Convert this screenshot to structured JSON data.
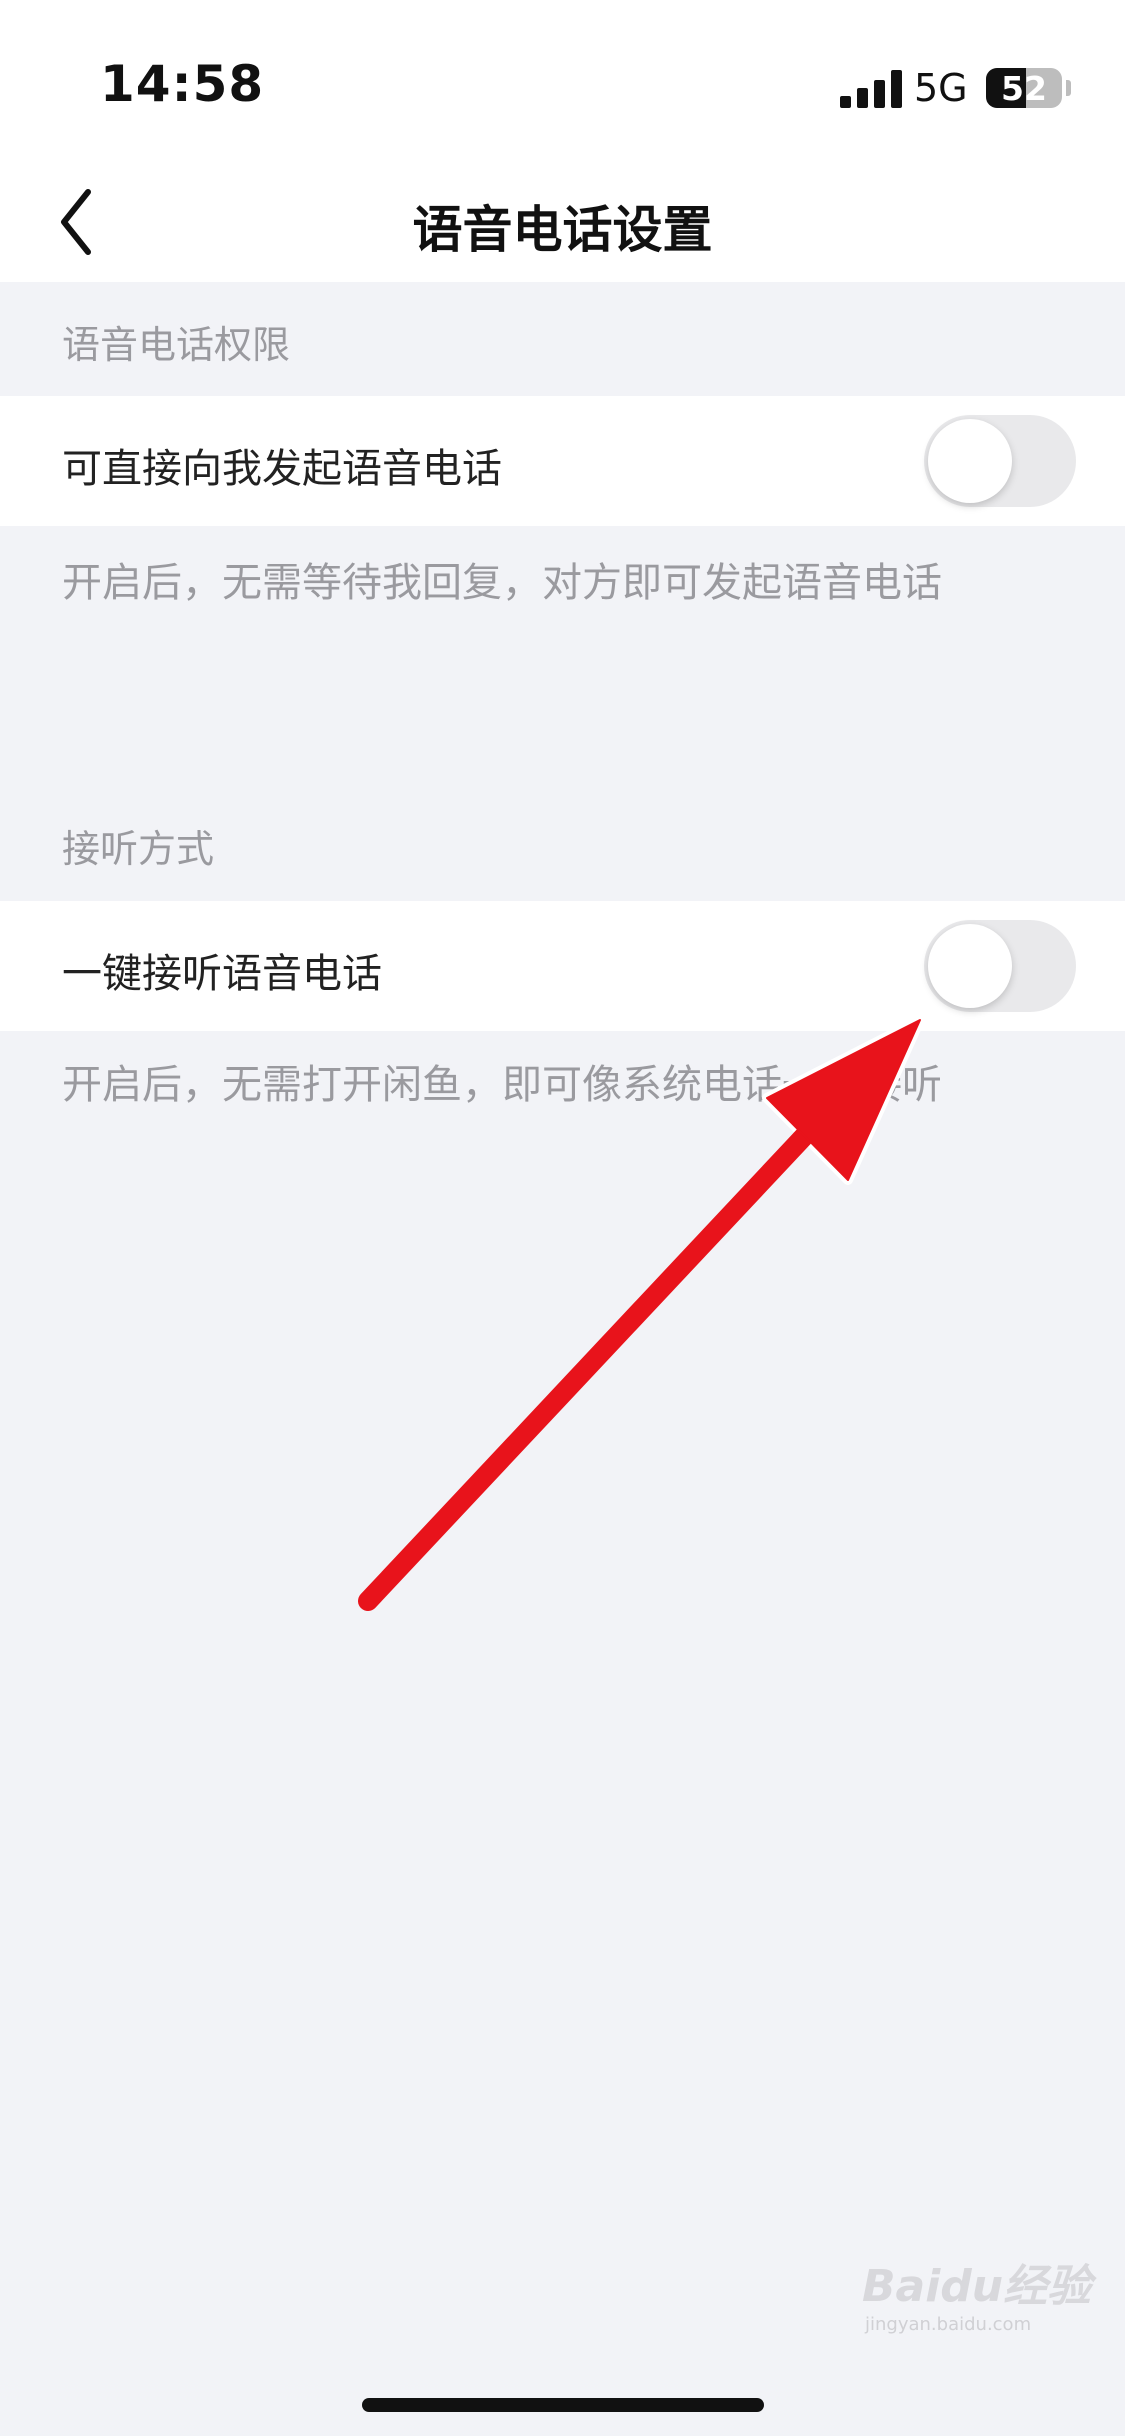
{
  "status_bar": {
    "time": "14:58",
    "network": "5G",
    "battery": "52",
    "battery_level": 0.52,
    "signal_icon": "cellular-signal-icon",
    "battery_icon": "battery-icon"
  },
  "nav": {
    "title": "语音电话设置",
    "back_icon": "chevron-left-icon"
  },
  "sections": [
    {
      "header": "语音电话权限",
      "row_label": "可直接向我发起语音电话",
      "toggle_on": false,
      "description": "开启后，无需等待我回复，对方即可发起语音电话"
    },
    {
      "header": "接听方式",
      "row_label": "一键接听语音电话",
      "toggle_on": false,
      "description": "开启后，无需打开闲鱼，即可像系统电话一样接听"
    }
  ],
  "annotation": {
    "arrow_color": "#e8131b"
  },
  "watermark": {
    "text": "Baidu经验",
    "sub": "jingyan.baidu.com"
  }
}
